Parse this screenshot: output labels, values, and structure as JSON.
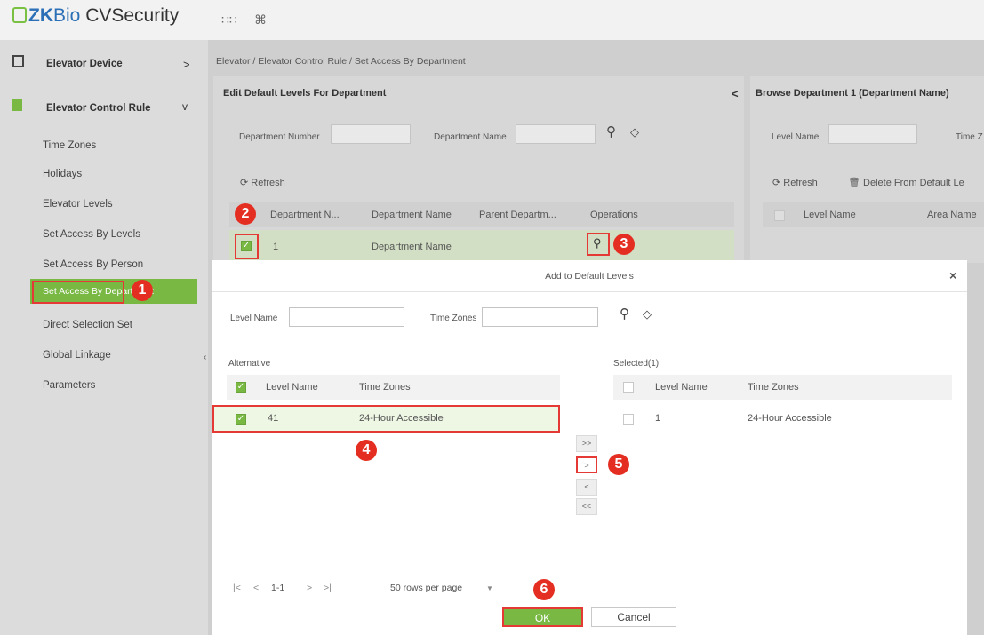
{
  "header": {
    "logo_zk": "ZK",
    "logo_bio": "Bio",
    "logo_product": " CVSecurity",
    "apps_icon": "grid-icon",
    "command_icon": "command-icon"
  },
  "sidebar": {
    "menus": [
      {
        "label": "Elevator Device",
        "icon": "device-icon",
        "chevron": ">"
      },
      {
        "label": "Elevator Control Rule",
        "icon": "rule-icon",
        "chevron": "v"
      }
    ],
    "items": [
      "Time Zones",
      "Holidays",
      "Elevator Levels",
      "Set Access By Levels",
      "Set Access By Person",
      "Set Access By Department",
      "Direct Selection Set",
      "Global Linkage",
      "Parameters"
    ],
    "active_index": 5
  },
  "breadcrumb": "Elevator / Elevator Control Rule / Set Access By Department",
  "left_panel": {
    "title": "Edit Default Levels For Department",
    "collapse": "<",
    "filters": [
      {
        "label": "Department Number",
        "value": ""
      },
      {
        "label": "Department Name",
        "value": ""
      }
    ],
    "refresh": "Refresh",
    "columns": [
      "Department N...",
      "Department Name",
      "Parent Departm...",
      "Operations"
    ],
    "rows": [
      {
        "number": "1",
        "name": "Department Name",
        "parent": "",
        "checked": true
      }
    ]
  },
  "right_panel": {
    "title": "Browse Department 1  (Department Name)",
    "filters": [
      {
        "label": "Level Name",
        "value": ""
      },
      {
        "label": "Time Z",
        "value": ""
      }
    ],
    "refresh": "Refresh",
    "delete": "Delete From Default Le",
    "columns": [
      "Level Name",
      "Area Name"
    ]
  },
  "dialog": {
    "title": "Add to Default Levels",
    "close": "×",
    "filters": [
      {
        "label": "Level Name",
        "value": ""
      },
      {
        "label": "Time Zones",
        "value": ""
      }
    ],
    "alternative_label": "Alternative",
    "selected_label": "Selected(1)",
    "columns": [
      "Level Name",
      "Time Zones"
    ],
    "alternative_rows": [
      {
        "level": "41",
        "zone": "24-Hour Accessible",
        "checked": true
      }
    ],
    "selected_rows": [
      {
        "level": "1",
        "zone": "24-Hour Accessible",
        "checked": false
      }
    ],
    "move_buttons": [
      ">>",
      ">",
      "<",
      "<<"
    ],
    "pagination": {
      "first": "|<",
      "prev": "<",
      "range": "1-1",
      "next": ">",
      "last": ">|",
      "rows_per_page": "50 rows per page",
      "dropdown": "▼"
    },
    "ok": "OK",
    "cancel": "Cancel"
  },
  "annotations": [
    "1",
    "2",
    "3",
    "4",
    "5",
    "6"
  ],
  "colors": {
    "accent_green": "#78b843",
    "annotation_red": "#e52e22",
    "brand_blue": "#2b6fb6"
  }
}
